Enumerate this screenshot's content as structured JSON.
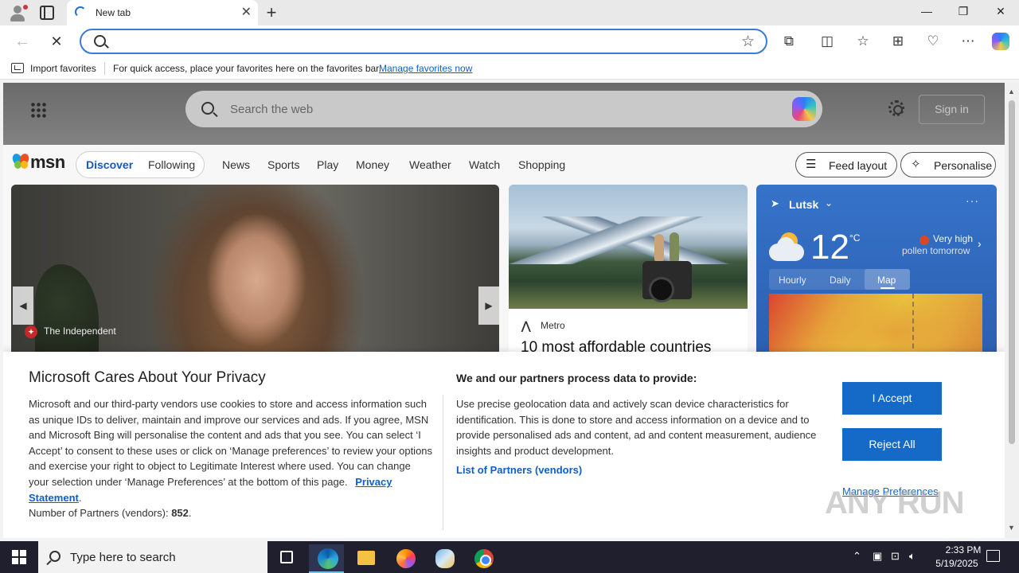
{
  "browser": {
    "tab_title": "New tab",
    "address_value": "",
    "favorites_bar": {
      "import_label": "Import favorites",
      "message": "For quick access, place your favorites here on the favorites bar.",
      "manage_link": "Manage favorites now"
    }
  },
  "msn": {
    "search_placeholder": "Search the web",
    "signin_label": "Sign in",
    "logo_text": "msn",
    "nav_pill": {
      "discover": "Discover",
      "following": "Following"
    },
    "nav_links": [
      "News",
      "Sports",
      "Play",
      "Money",
      "Weather",
      "Watch",
      "Shopping"
    ],
    "feed_layout_label": "Feed layout",
    "personalise_label": "Personalise",
    "hero": {
      "source": "The Independent"
    },
    "card2": {
      "source": "Metro",
      "headline": "10 most affordable countries"
    },
    "weather": {
      "location": "Lutsk",
      "temperature": "12",
      "unit": "°C",
      "pollen_line1": "Very high",
      "pollen_line2": "pollen tomorrow",
      "tabs": [
        "Hourly",
        "Daily",
        "Map"
      ],
      "active_tab": "Map"
    }
  },
  "privacy": {
    "title": "Microsoft Cares About Your Privacy",
    "body": "Microsoft and our third-party vendors use cookies to store and access information such as unique IDs to deliver, maintain and improve our services and ads. If you agree, MSN and Microsoft Bing will personalise the content and ads that you see. You can select ‘I Accept’ to consent to these uses or click on ‘Manage preferences’ to review your options and exercise your right to object to Legitimate Interest where used.  You can change your selection under ‘Manage Preferences’ at the bottom of this page.",
    "privacy_link": "Privacy Statement",
    "partners_count_label": "Number of Partners (vendors):",
    "partners_count": "852",
    "data_title": "We and our partners process data to provide:",
    "data_body": "Use precise geolocation data and actively scan device characteristics for identification. This is done to store and access information on a device and to provide personalised ads and content, ad and content measurement, audience insights and product development.",
    "partners_link": "List of Partners (vendors)",
    "accept_label": "I Accept",
    "reject_label": "Reject All",
    "manage_label": "Manage Preferences"
  },
  "watermark": "ANY RUN",
  "taskbar": {
    "search_placeholder": "Type here to search",
    "time": "2:33 PM",
    "date": "5/19/2025"
  },
  "icons": {
    "tab": "edge-loading-icon",
    "back": "back-arrow-icon",
    "stop": "stop-icon",
    "star": "favorite-star-icon",
    "extensions": "extensions-icon",
    "split": "split-screen-icon",
    "favorites": "favorites-icon",
    "collections": "collections-icon",
    "performance": "performance-icon",
    "more": "more-icon",
    "copilot": "copilot-icon"
  },
  "colors": {
    "accent": "#1569c7",
    "link": "#0f5fc6",
    "weather_bg": "#3673c9",
    "taskbar": "#1f1f2e"
  }
}
